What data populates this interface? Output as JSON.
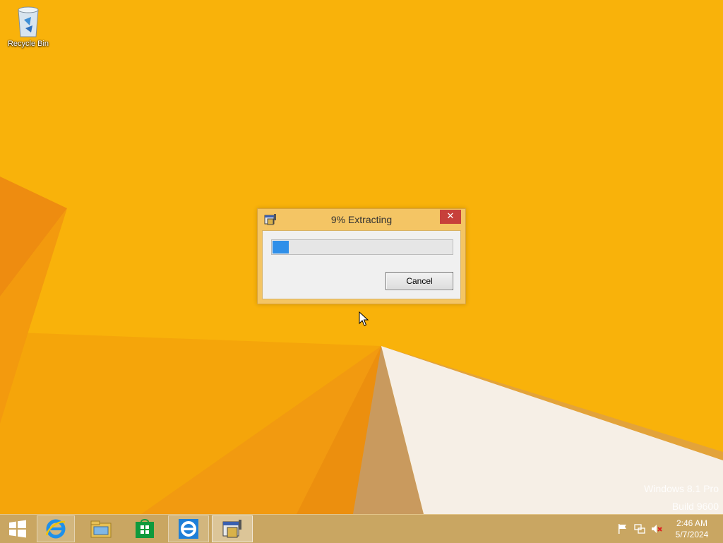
{
  "desktop": {
    "icons": [
      {
        "label": "Recycle Bin",
        "icon": "recycle-bin-icon"
      }
    ],
    "watermark": {
      "line1": "Windows 8.1 Pro",
      "line2": "Build 9600"
    }
  },
  "dialog": {
    "title": "9% Extracting",
    "close_label": "✕",
    "progress_percent": 9,
    "cancel_label": "Cancel",
    "icon": "installer-app-icon"
  },
  "taskbar": {
    "items": [
      "start-icon",
      "internet-explorer-icon",
      "file-explorer-icon",
      "store-icon",
      "internet-explorer-icon",
      "installer-app-icon"
    ],
    "tray": [
      "action-center-flag-icon",
      "network-icon",
      "volume-muted-icon"
    ],
    "clock": {
      "time": "2:46 AM",
      "date": "5/7/2024"
    }
  },
  "colors": {
    "desktop_bg": "#f9b20a",
    "accent_dark": "#e97f0d",
    "dialog_frame": "#f4c564",
    "progress_fill": "#2f8fe9",
    "close_button": "#c7403a",
    "taskbar": "#c9a662"
  }
}
